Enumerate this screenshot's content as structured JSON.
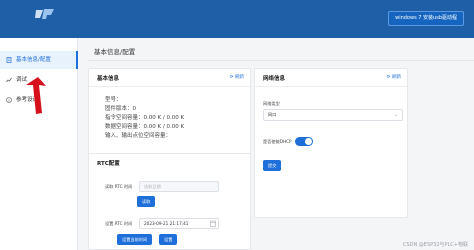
{
  "header": {
    "logo_text": "",
    "driver_button_label": "windows 7 安装usb驱动程"
  },
  "sidebar": {
    "items": [
      {
        "label": "基本信息/配置",
        "icon": "document-icon",
        "active": true
      },
      {
        "label": "调试",
        "icon": "chart-icon",
        "active": false
      },
      {
        "label": "参考设计",
        "icon": "info-icon",
        "active": false
      }
    ]
  },
  "main": {
    "page_title": "基本信息/配置",
    "basic_info": {
      "title": "基本信息",
      "refresh_label": "刷新",
      "lines": [
        "型号：",
        "固件版本：0",
        "指令空间容量：0.00 K / 0.00 K",
        "数据空间容量：0.00 K / 0.00 K",
        "输入、输出点位空间容量："
      ]
    },
    "rtc": {
      "title": "RTC配置",
      "read_label": "读取 RTC 时间",
      "read_placeholder": "选取日期",
      "read_button": "读取",
      "set_label": "设置 RTC 时间",
      "set_value": "2023-09-21 21:17:41",
      "use_current_button": "设置当前时间",
      "set_button": "设置"
    },
    "network": {
      "title": "网络信息",
      "refresh_label": "刷新",
      "type_label": "网络类型",
      "type_value": "网口",
      "dhcp_label": "是否使能DHCP",
      "dhcp_enabled": true,
      "submit_button": "提交"
    }
  },
  "watermark": "CSDN @ESP32与PLC+物联",
  "colors": {
    "header_bg": "#1f5fa8",
    "accent": "#1e6fd9",
    "arrow": "#d6101a"
  }
}
